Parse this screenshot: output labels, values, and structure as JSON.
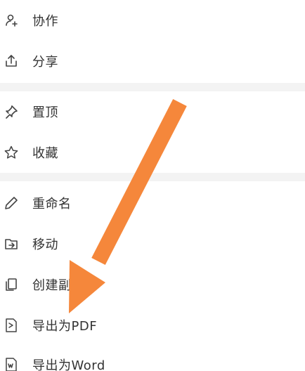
{
  "menu": {
    "group1": [
      {
        "icon": "person-add-icon",
        "label": "协作"
      },
      {
        "icon": "share-icon",
        "label": "分享"
      }
    ],
    "group2": [
      {
        "icon": "pin-icon",
        "label": "置顶"
      },
      {
        "icon": "star-icon",
        "label": "收藏"
      }
    ],
    "group3": [
      {
        "icon": "pencil-icon",
        "label": "重命名"
      },
      {
        "icon": "folder-move-icon",
        "label": "移动"
      },
      {
        "icon": "copy-icon",
        "label": "创建副本"
      },
      {
        "icon": "pdf-file-icon",
        "label": "导出为PDF"
      },
      {
        "icon": "word-file-icon",
        "label": "导出为Word"
      }
    ]
  },
  "annotation": {
    "arrow_color": "#F5873B"
  }
}
